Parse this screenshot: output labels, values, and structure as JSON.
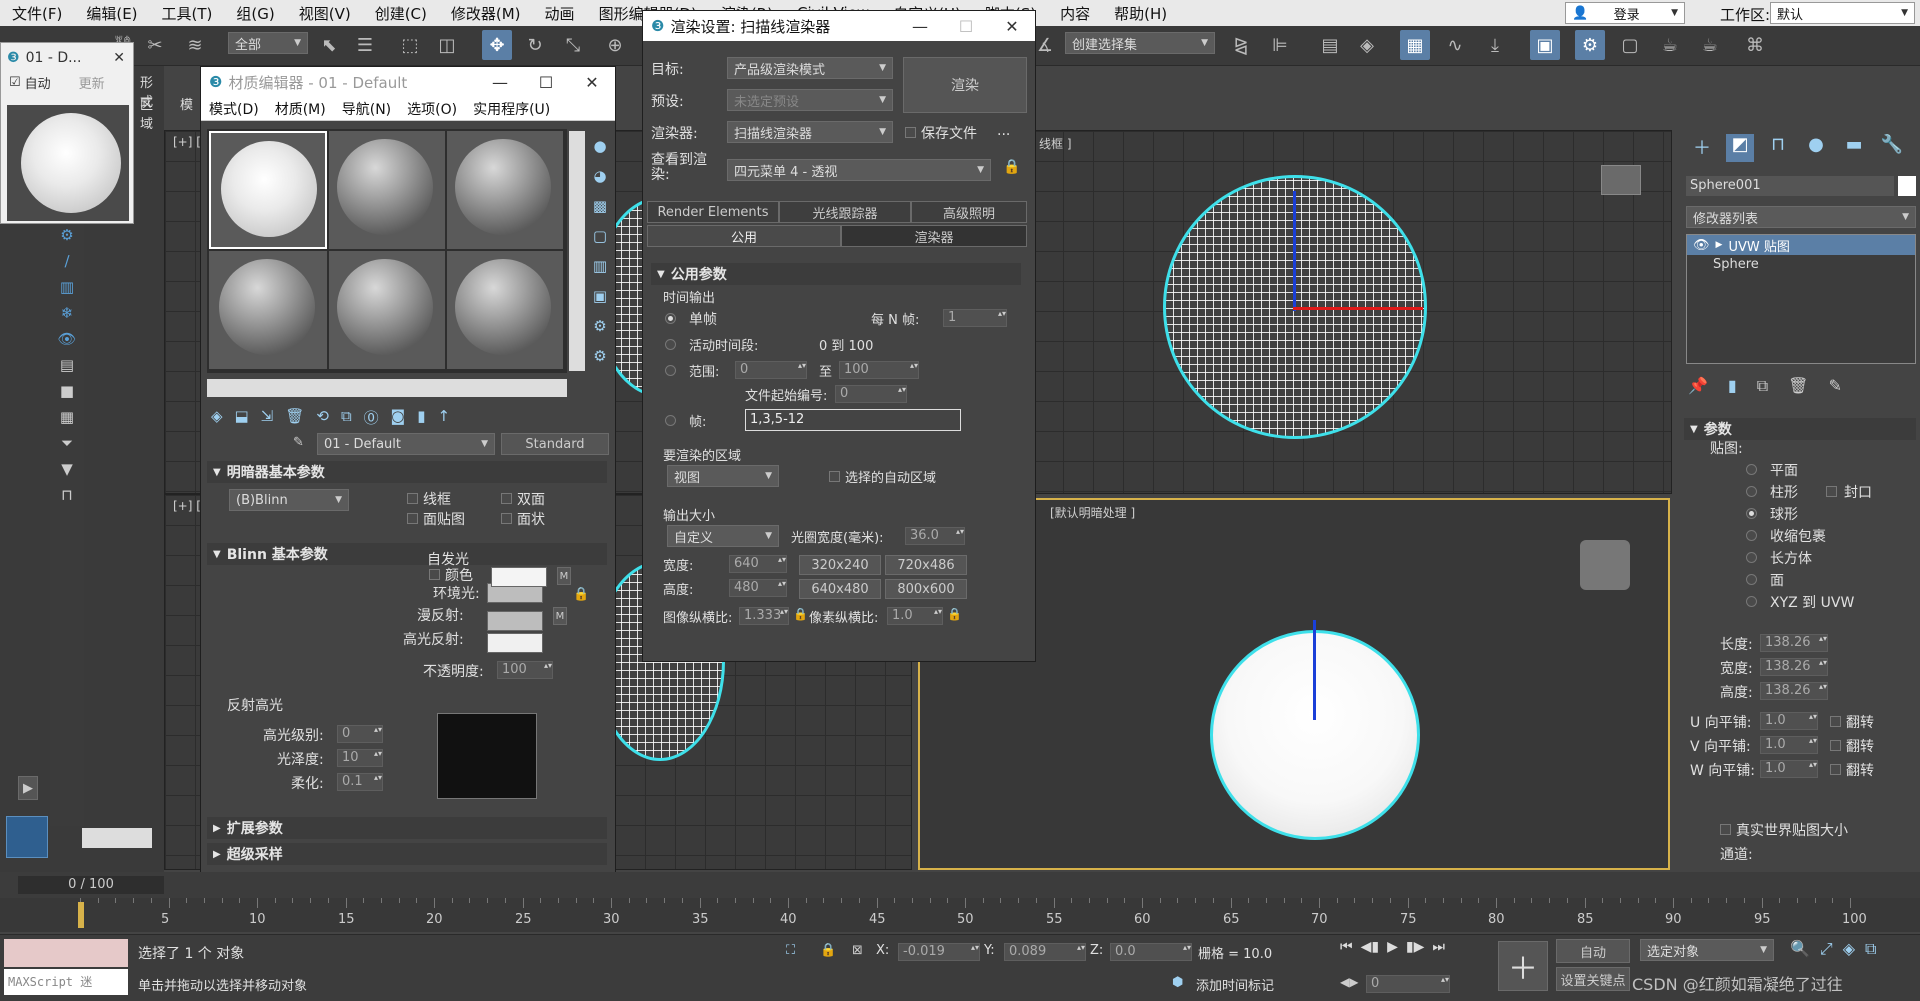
{
  "menu": [
    "文件(F)",
    "编辑(E)",
    "工具(T)",
    "组(G)",
    "视图(V)",
    "创建(C)",
    "修改器(M)",
    "动画",
    "图形编辑器(D)",
    "渲染(R)",
    "Civil View",
    "自定义(U)",
    "脚本(S)",
    "内容",
    "帮助(H)"
  ],
  "login": "登录",
  "workspace_label": "工作区:",
  "workspace_value": "默认",
  "toolbar": {
    "filter": "全部",
    "selection_set": "创建选择集"
  },
  "left_ribbon": {
    "tab1": "形式",
    "tab2": "区域",
    "tab3": "模"
  },
  "small_window": {
    "title": "01 - D...",
    "auto": "自动",
    "update": "更新"
  },
  "material_editor": {
    "title": "材质编辑器 - 01 - Default",
    "menus": [
      "模式(D)",
      "材质(M)",
      "导航(N)",
      "选项(O)",
      "实用程序(U)"
    ],
    "material_name": "01 - Default",
    "material_type": "Standard",
    "shader_section": "明暗器基本参数",
    "shader": "(B)Blinn",
    "wire": "线框",
    "two_sided": "双面",
    "face_map": "面贴图",
    "faceted": "面状",
    "blinn_section": "Blinn 基本参数",
    "self_illum": "自发光",
    "color": "颜色",
    "ambient": "环境光:",
    "diffuse": "漫反射:",
    "specular": "高光反射:",
    "opacity": "不透明度:",
    "opacity_value": "100",
    "spec_highlights": "反射高光",
    "spec_level": "高光级别:",
    "spec_level_value": "0",
    "glossiness": "光泽度:",
    "glossiness_value": "10",
    "soften": "柔化:",
    "soften_value": "0.1",
    "extended": "扩展参数",
    "supersampling": "超级采样",
    "m_label": "M",
    "self_illum_m": "M"
  },
  "render_setup": {
    "title": "渲染设置: 扫描线渲染器",
    "target_label": "目标:",
    "target": "产品级渲染模式",
    "preset_label": "预设:",
    "preset": "未选定预设",
    "renderer_label": "渲染器:",
    "renderer": "扫描线渲染器",
    "save_file": "保存文件",
    "view_label": "查看到渲染:",
    "view": "四元菜单 4 - 透视",
    "render_button": "渲染",
    "more": "...",
    "tabs_row1": [
      "Render Elements",
      "光线跟踪器",
      "高级照明"
    ],
    "tabs_row2": [
      "公用",
      "渲染器"
    ],
    "common_params": "公用参数",
    "time_output": "时间输出",
    "single": "单帧",
    "every_n": "每 N 帧:",
    "every_n_value": "1",
    "active_segment": "活动时间段:",
    "active_range": "0 到 100",
    "range": "范围:",
    "range_from": "0",
    "range_to_label": "至",
    "range_to": "100",
    "file_number_base": "文件起始编号:",
    "file_number_value": "0",
    "frames": "帧:",
    "frames_value": "1,3,5-12",
    "area_title": "要渲染的区域",
    "area": "视图",
    "auto_region": "选择的自动区域",
    "output_size": "输出大小",
    "size_preset": "自定义",
    "aperture": "光圈宽度(毫米):",
    "aperture_value": "36.0",
    "width_label": "宽度:",
    "width": "640",
    "height_label": "高度:",
    "height": "480",
    "presets": [
      "320x240",
      "720x486",
      "640x480",
      "800x600"
    ],
    "image_aspect": "图像纵横比:",
    "image_aspect_value": "1.333",
    "pixel_aspect": "像素纵横比:",
    "pixel_aspect_value": "1.0"
  },
  "viewports": {
    "top_right_label": "线框 ]",
    "bottom_right_label": "[默认明暗处理 ]",
    "top_left_label": "[+] [",
    "bottom_left_label": "[+] ["
  },
  "command_panel": {
    "object_name": "Sphere001",
    "modifier_list": "修改器列表",
    "stack": [
      "UVW 贴图",
      "Sphere"
    ],
    "params": "参数",
    "mapping": "贴图:",
    "mapping_types": [
      "平面",
      "柱形",
      "球形",
      "收缩包裹",
      "长方体",
      "面",
      "XYZ 到 UVW"
    ],
    "cap": "封口",
    "length_label": "长度:",
    "length": "138.26",
    "width_label": "宽度:",
    "width": "138.26",
    "height_label": "高度:",
    "height": "138.26",
    "u_tile": "U 向平铺:",
    "v_tile": "V 向平铺:",
    "w_tile": "W 向平铺:",
    "tile_value": "1.0",
    "flip": "翻转",
    "real_world": "真实世界贴图大小",
    "channel": "通道:"
  },
  "timeline": {
    "frame": "0 / 100",
    "ticks": [
      "5",
      "10",
      "15",
      "20",
      "25",
      "30",
      "35",
      "40",
      "45",
      "50",
      "55",
      "60",
      "65",
      "70",
      "75",
      "80",
      "85",
      "90",
      "95",
      "100"
    ]
  },
  "status": {
    "maxscript": "MAXScript 迷",
    "selected": "选择了 1 个 对象",
    "hint": "单击并拖动以选择并移动对象",
    "x_label": "X:",
    "x": "-0.019",
    "y_label": "Y:",
    "y": "0.089",
    "z_label": "Z:",
    "z": "0.0",
    "grid": "栅格 = 10.0",
    "add_tag": "添加时间标记",
    "auto": "自动",
    "selected_obj": "选定对象",
    "set_key": "设置关键点",
    "frame_field": "0",
    "watermark": "CSDN @红颜如霜凝绝了过往"
  }
}
